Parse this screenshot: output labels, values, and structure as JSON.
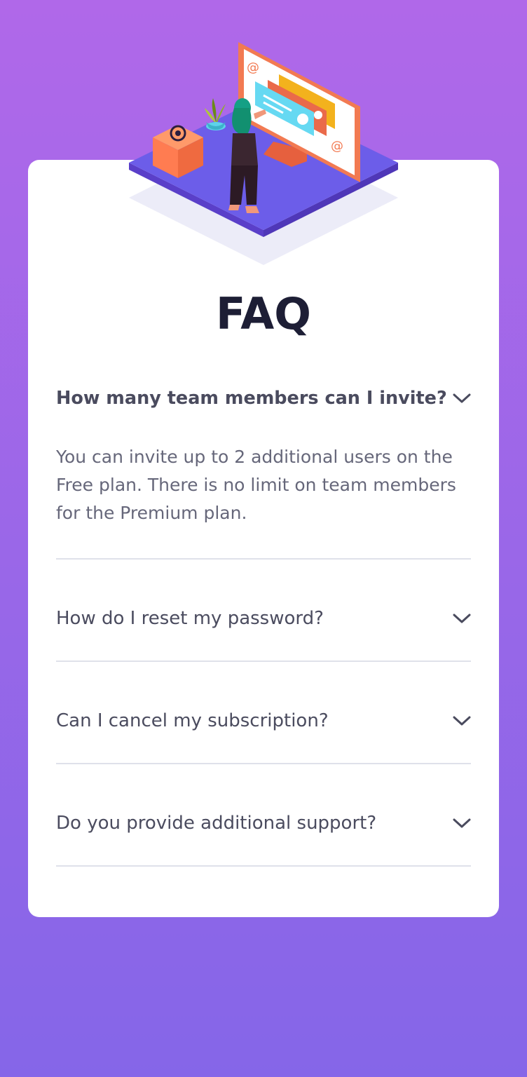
{
  "page": {
    "title": "FAQ"
  },
  "faq": [
    {
      "question": "How many team members can I invite?",
      "answer": "You can invite up to 2 additional users on the Free plan. There is no limit on team members for the Premium plan.",
      "expanded": true
    },
    {
      "question": "How do I reset my password?",
      "expanded": false
    },
    {
      "question": "Can I cancel my subscription?",
      "expanded": false
    },
    {
      "question": "Do you provide additional support?",
      "expanded": false
    }
  ],
  "icons": {
    "chevron": "chevron-down-icon",
    "illustration": "woman-online-illustration"
  },
  "colors": {
    "background_top": "#b068e9",
    "background_bottom": "#8566e8",
    "title": "#1d1e35",
    "question": "#4b4c5f",
    "answer": "#66677a",
    "accent": "#f47b56"
  }
}
